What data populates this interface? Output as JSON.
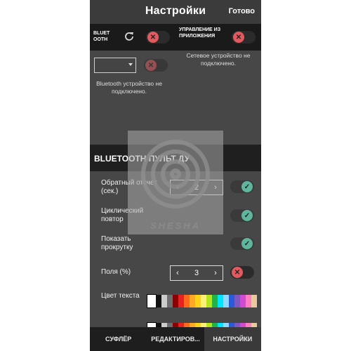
{
  "header": {
    "title": "Настройки",
    "done_label": "Готово"
  },
  "connection": {
    "bluetooth_label": "BLUETOOTH",
    "bluetooth_toggle": "off",
    "refresh_icon": "refresh-icon",
    "app_control_label": "УПРАВЛЕНИЕ ИЗ ПРИЛОЖЕНИЯ",
    "app_control_toggle": "off",
    "network_status": "Сетевое устройство не подключено.",
    "bluetooth_status": "Bluetooth устройство не подключено.",
    "device_select_value": ""
  },
  "remote": {
    "section_title": "BLUETOOTH ПУЛЬТ ДУ",
    "countdown_label": "Обратный отсчет (сек.)",
    "countdown_value": "2",
    "countdown_toggle": "on",
    "loop_label": "Циклический повтор",
    "loop_toggle": "on",
    "show_scroll_label": "Показать прокрутку",
    "show_scroll_toggle": "on",
    "margins_label": "Поля (%)",
    "margins_value": "3",
    "margins_toggle": "off",
    "text_color_label": "Цвет текста",
    "palette": [
      "#ffffff",
      "#111111",
      "#cccccc",
      "#6e6e6e",
      "#8b0000",
      "#e52222",
      "#ff6a1a",
      "#ffa826",
      "#ffd11a",
      "#fff176",
      "#b5e61d",
      "#1fb34a",
      "#00e5ff",
      "#8fd8ff",
      "#2a5bd7",
      "#7e57c2",
      "#d04bd0",
      "#ff7fbf",
      "#e9c9a0"
    ],
    "stepper_prev": "‹",
    "stepper_next": "›"
  },
  "watermark": {
    "text": "SHESHA"
  },
  "tabs": [
    {
      "label": "СУФЛЁР"
    },
    {
      "label": "РЕДАКТИРОВ..."
    },
    {
      "label": "НАСТРОЙКИ"
    }
  ],
  "colors": {
    "toggle_off": "#e05a5f",
    "toggle_on": "#5fb59e",
    "background": "#474747"
  }
}
